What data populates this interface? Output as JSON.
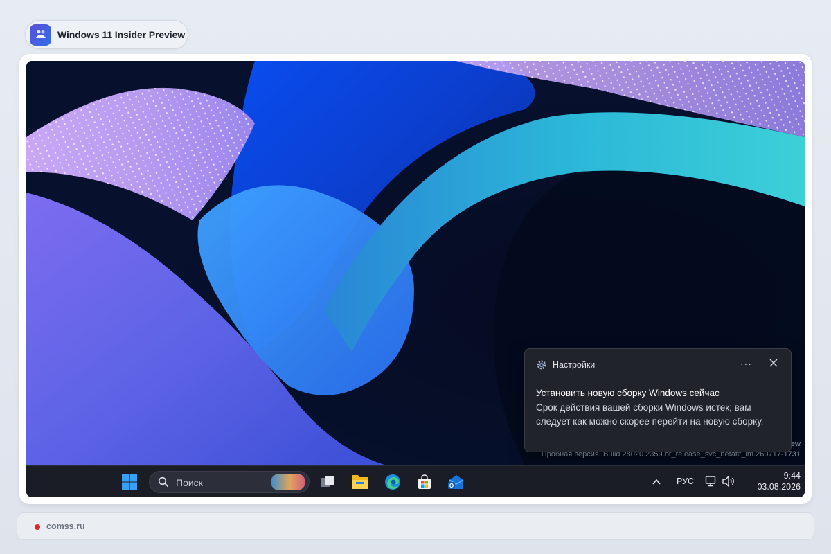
{
  "header": {
    "title": "Windows 11 Insider Preview",
    "logo_icon": "insider-logo-icon"
  },
  "desktop": {
    "watermark_line1": "ew",
    "watermark_line2": "Пробная версия. Build 28020.2359.br_release_svc_betafit_im.260717-1731"
  },
  "notification": {
    "app_name": "Настройки",
    "app_icon": "gear-icon",
    "more_label": "···",
    "title": "Установить новую сборку Windows сейчас",
    "body": "Срок действия вашей сборки Windows истек; вам следует как можно скорее перейти на новую сборку."
  },
  "taskbar": {
    "search_placeholder": "Поиск",
    "pinned": [
      "start-icon",
      "task-view-icon",
      "file-explorer-icon",
      "edge-icon",
      "store-icon",
      "outlook-icon"
    ],
    "language": "РУС",
    "time": "9:44",
    "date": "03.08.2026"
  },
  "footer": {
    "source": "comss.ru",
    "dot_color": "#e3262a"
  }
}
